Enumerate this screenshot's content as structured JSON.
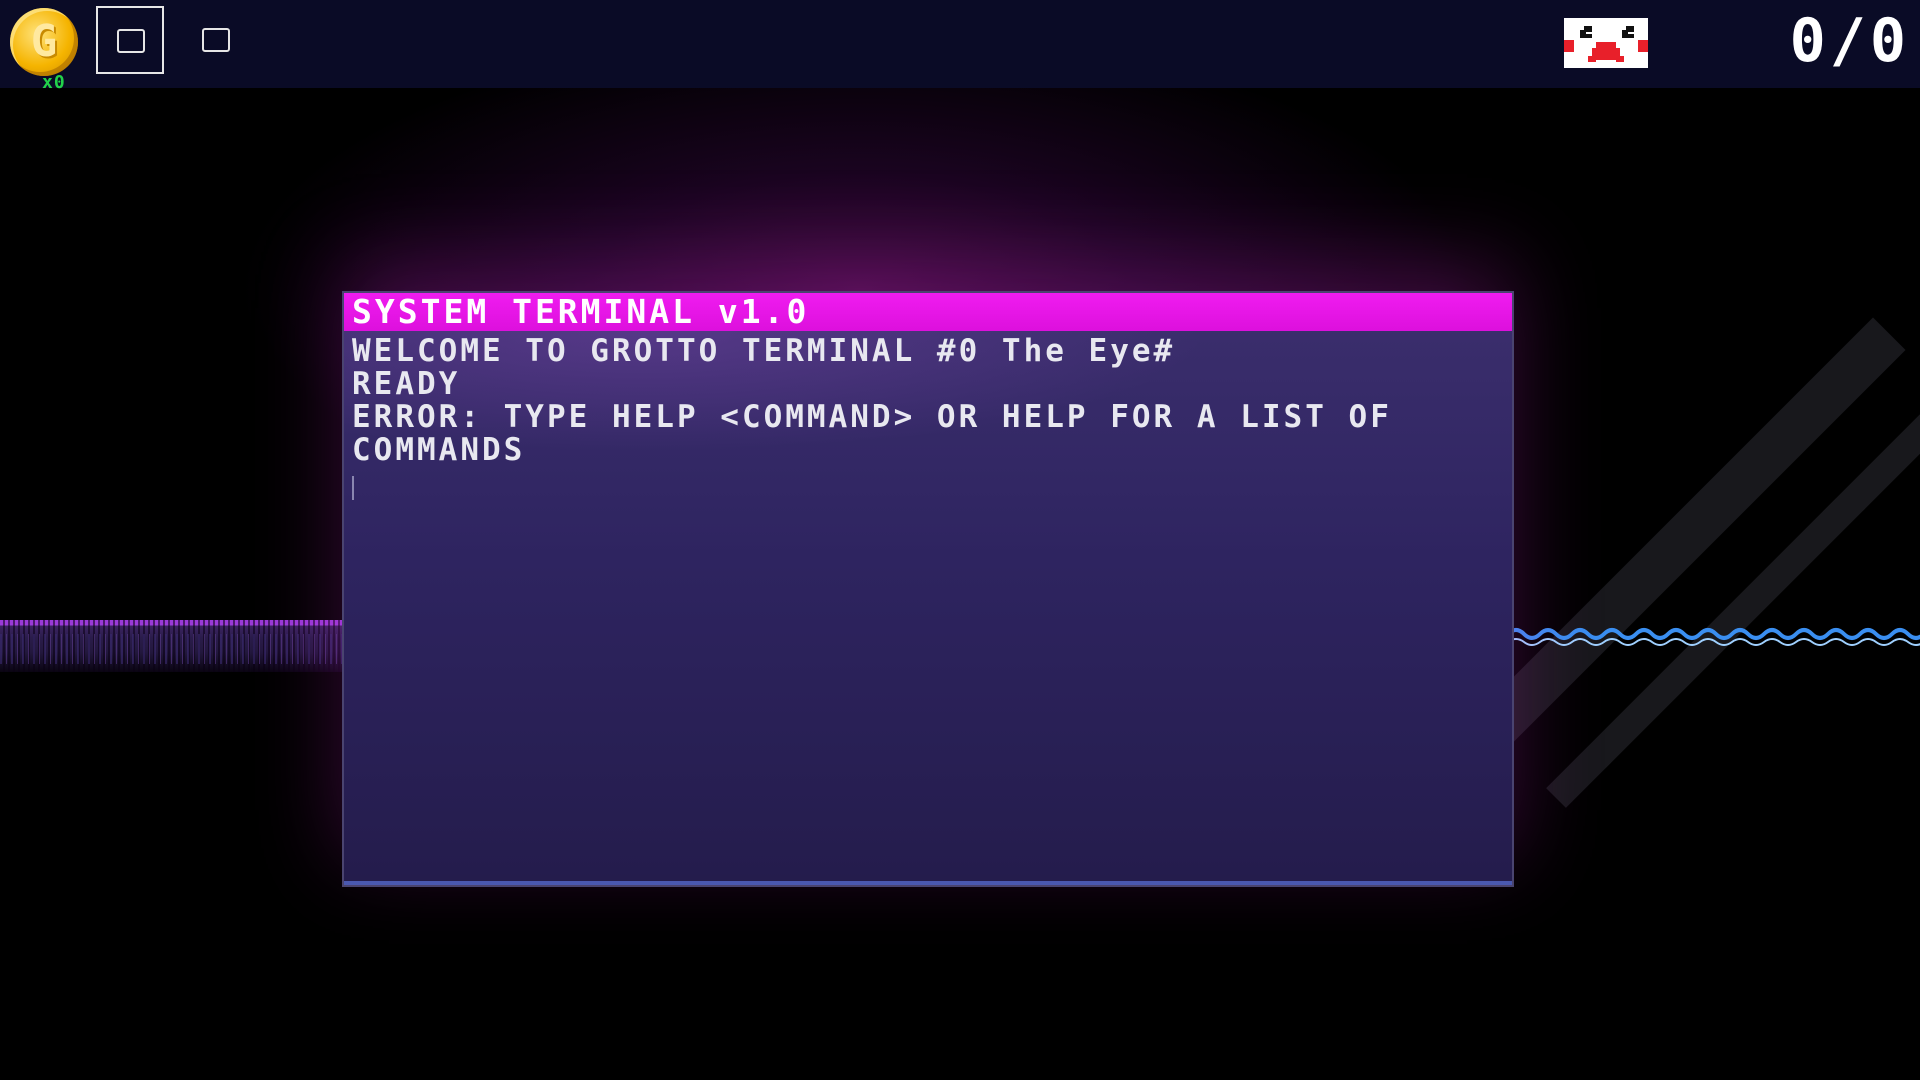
{
  "hud": {
    "coin_glyph": "G",
    "coin_count": "x0",
    "score": "0/0",
    "accent_colors": {
      "coin": "#f5b400",
      "coin_count": "#22d24a",
      "hud_bar": "#0a0b26"
    },
    "icons": {
      "coin": "gold-coin-icon",
      "slot_1": "item-slot-selected",
      "slot_2": "item-slot",
      "face": "pixel-face-icon"
    }
  },
  "terminal": {
    "title": "SYSTEM TERMINAL v1.0",
    "lines": [
      "WELCOME TO GROTTO TERMINAL #0 The Eye#",
      "READY",
      "ERROR: TYPE HELP <COMMAND> OR HELP FOR A LIST OF COMMANDS"
    ],
    "input_value": "",
    "colors": {
      "titlebar": "#f01cf0",
      "body": "#2e2460",
      "text": "#e8e8f0"
    }
  }
}
